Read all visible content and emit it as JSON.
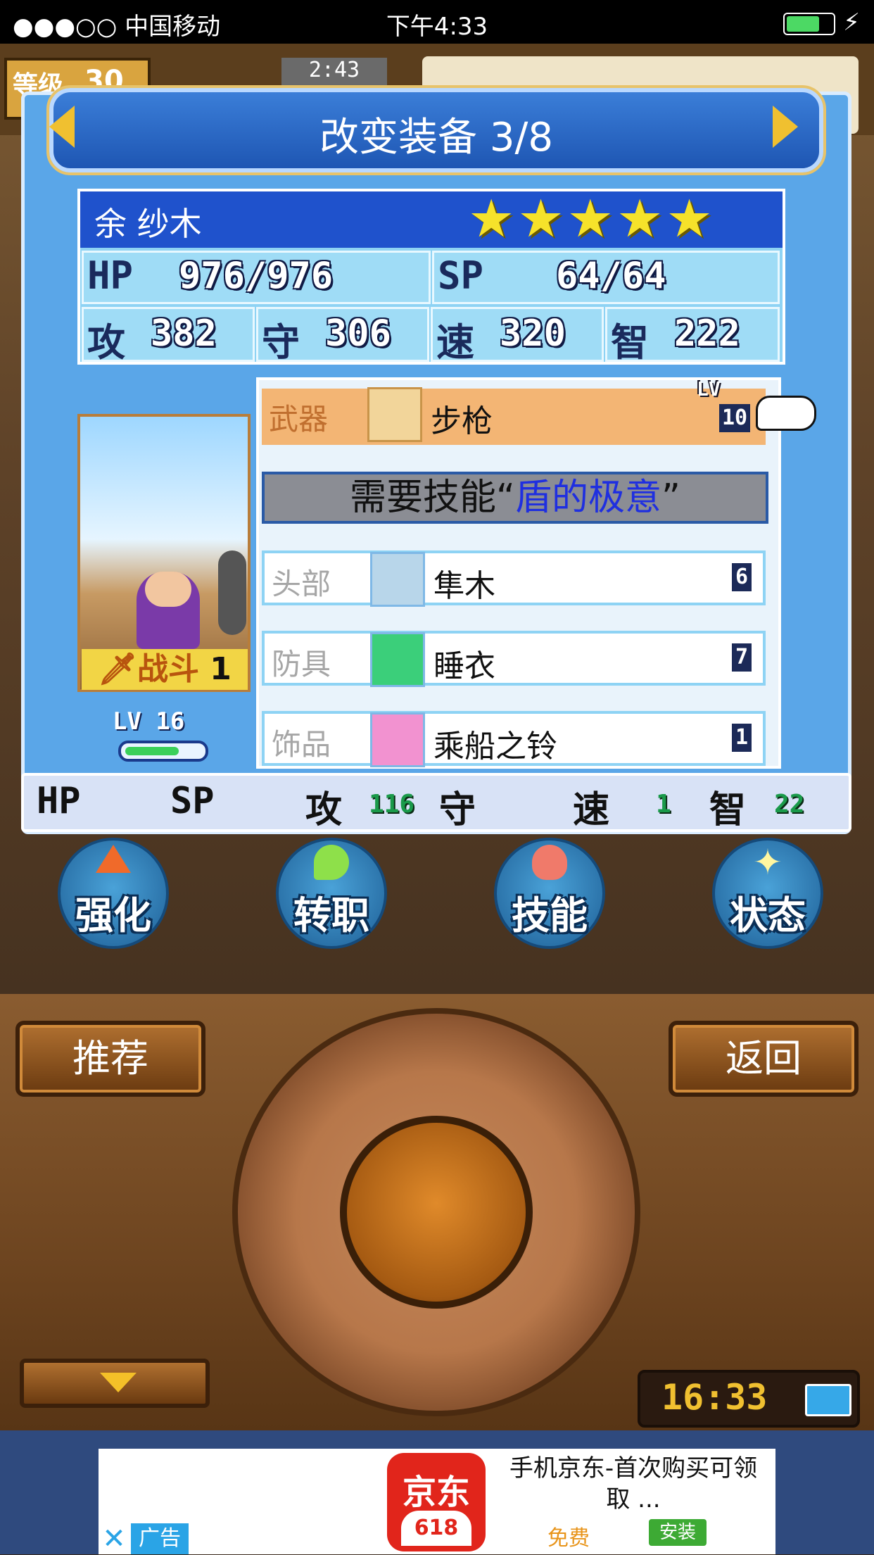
{
  "status_bar": {
    "carrier": "●●●○○ 中国移动",
    "time": "下午4:33"
  },
  "hud": {
    "level_label": "等级",
    "level_value": "30",
    "clock": "2:43"
  },
  "header": {
    "title": "改变装备 3/8"
  },
  "character": {
    "name": "余 纱木",
    "stars": "★★★★★",
    "hp_label": "HP",
    "hp": "976/976",
    "sp_label": "SP",
    "sp": "64/64",
    "atk_label": "攻",
    "atk": "382",
    "def_label": "守",
    "def": "306",
    "spd_label": "速",
    "spd": "320",
    "int_label": "智",
    "int": "222",
    "job": "战斗",
    "job_rank": "1",
    "level_text": "LV 16",
    "exp_fraction": 0.7
  },
  "equipment": {
    "weapon": {
      "slot": "武器",
      "name": "步枪",
      "lv_tag": "LV",
      "level": "10"
    },
    "requirement_prefix": "需要技能“",
    "requirement_skill": "盾的极意",
    "requirement_suffix": "”",
    "head": {
      "slot": "头部",
      "name": "隼木",
      "level": "6"
    },
    "armor": {
      "slot": "防具",
      "name": "睡衣",
      "level": "7"
    },
    "accessory": {
      "slot": "饰品",
      "name": "乘船之铃",
      "level": "1"
    }
  },
  "bonus_strip": {
    "hp": "HP",
    "sp": "SP",
    "atk": "攻",
    "atk_val": "116",
    "def": "守",
    "spd": "速",
    "spd_val": "1",
    "int": "智",
    "int_val": "22"
  },
  "actions": [
    "强化",
    "转职",
    "技能",
    "状态"
  ],
  "controller": {
    "recommend": "推荐",
    "back": "返回",
    "clock": "16:33"
  },
  "ad": {
    "logo_top": "京东",
    "logo_bottom": "618",
    "title": "手机京东-首次购买可领取 ...",
    "free": "免费",
    "install": "安装",
    "close": "✕",
    "tag": "广告"
  },
  "colors": {
    "panel": "#5aa6e8",
    "name_bar": "#1f52cc",
    "weapon_row": "#f3b574",
    "highlight": "#1f2fe0"
  }
}
